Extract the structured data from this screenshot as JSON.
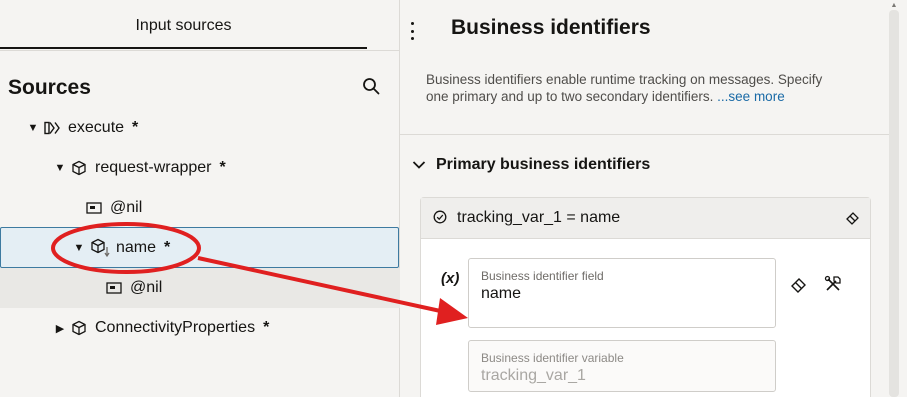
{
  "left_panel": {
    "tab_label": "Input sources",
    "sources_title": "Sources",
    "search_icon": "search-icon",
    "tree": [
      {
        "label": "execute",
        "required": "*",
        "icon": "execute-icon",
        "caret": "expanded"
      },
      {
        "label": "request-wrapper",
        "required": "*",
        "icon": "cube-icon",
        "caret": "expanded"
      },
      {
        "label": "@nil",
        "required": "",
        "icon": "attribute-icon",
        "caret": "none"
      },
      {
        "label": "name",
        "required": "*",
        "icon": "cube-down-icon",
        "caret": "expanded",
        "selected": true
      },
      {
        "label": "@nil",
        "required": "",
        "icon": "attribute-icon",
        "caret": "none"
      },
      {
        "label": "ConnectivityProperties",
        "required": "*",
        "icon": "cube-icon",
        "caret": "collapsed"
      }
    ]
  },
  "right_panel": {
    "title": "Business identifiers",
    "description": "Business identifiers enable runtime tracking on messages. Specify one primary and up to two secondary identifiers.",
    "see_more": "...see more",
    "section_title": "Primary business identifiers",
    "card": {
      "header": "tracking_var_1 = name",
      "fx_label": "(x)",
      "field": {
        "label": "Business identifier field",
        "value": "name"
      },
      "variable": {
        "label": "Business identifier variable",
        "value": "tracking_var_1"
      }
    }
  },
  "colors": {
    "selection_border": "#3d7aa0",
    "selection_bg": "#e4eef4",
    "link": "#1a6aa6",
    "annotation_red": "#e02020"
  }
}
